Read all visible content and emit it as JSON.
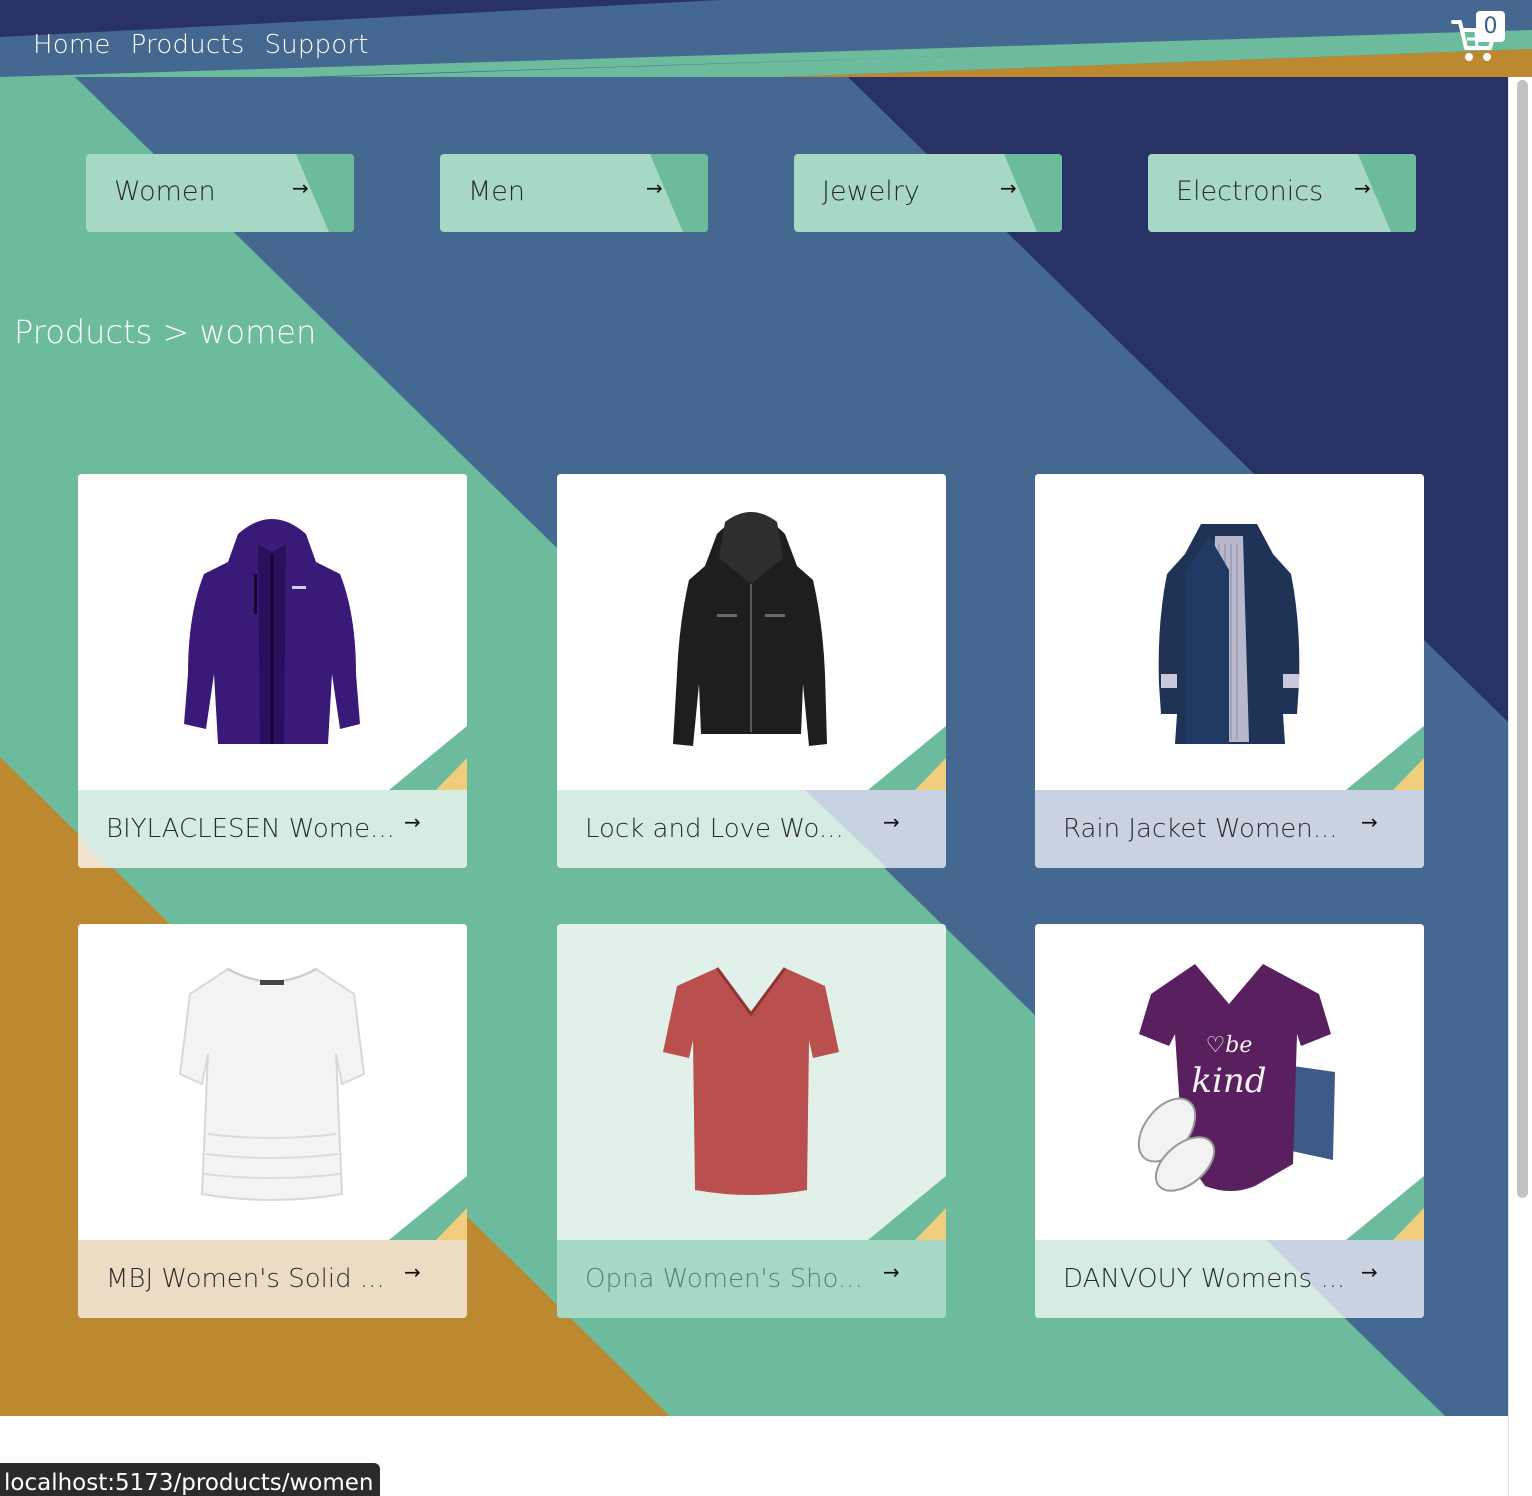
{
  "nav": {
    "home": "Home",
    "products": "Products",
    "support": "Support"
  },
  "cart": {
    "icon": "cart-icon",
    "count": "0"
  },
  "categories": [
    {
      "label": "Women",
      "icon": "arrow-right-icon"
    },
    {
      "label": "Men",
      "icon": "arrow-right-icon"
    },
    {
      "label": "Jewelry",
      "icon": "arrow-right-icon"
    },
    {
      "label": "Electronics",
      "icon": "arrow-right-icon"
    }
  ],
  "breadcrumb": "Products > women",
  "products": [
    {
      "title": "BIYLACLESEN Wome...",
      "image": "purple-jacket"
    },
    {
      "title": "Lock and Love Wo...",
      "image": "black-leather-jacket"
    },
    {
      "title": "Rain Jacket Women...",
      "image": "navy-rain-jacket"
    },
    {
      "title": "MBJ Women's Solid ...",
      "image": "white-top"
    },
    {
      "title": "Opna Women's Sho...",
      "image": "red-vneck-tee"
    },
    {
      "title": "DANVOUY Womens ...",
      "image": "be-kind-tee"
    }
  ],
  "arrow_glyph": "→",
  "status_url": "localhost:5173/products/women",
  "colors": {
    "navy": "#283264",
    "steel_blue": "#456890",
    "mint": "#6cbb9c",
    "mustard": "#bc8830",
    "light_mint": "#a7d7c5",
    "pale_blue": "#c8d2e0",
    "sand": "#ecdcc3"
  }
}
